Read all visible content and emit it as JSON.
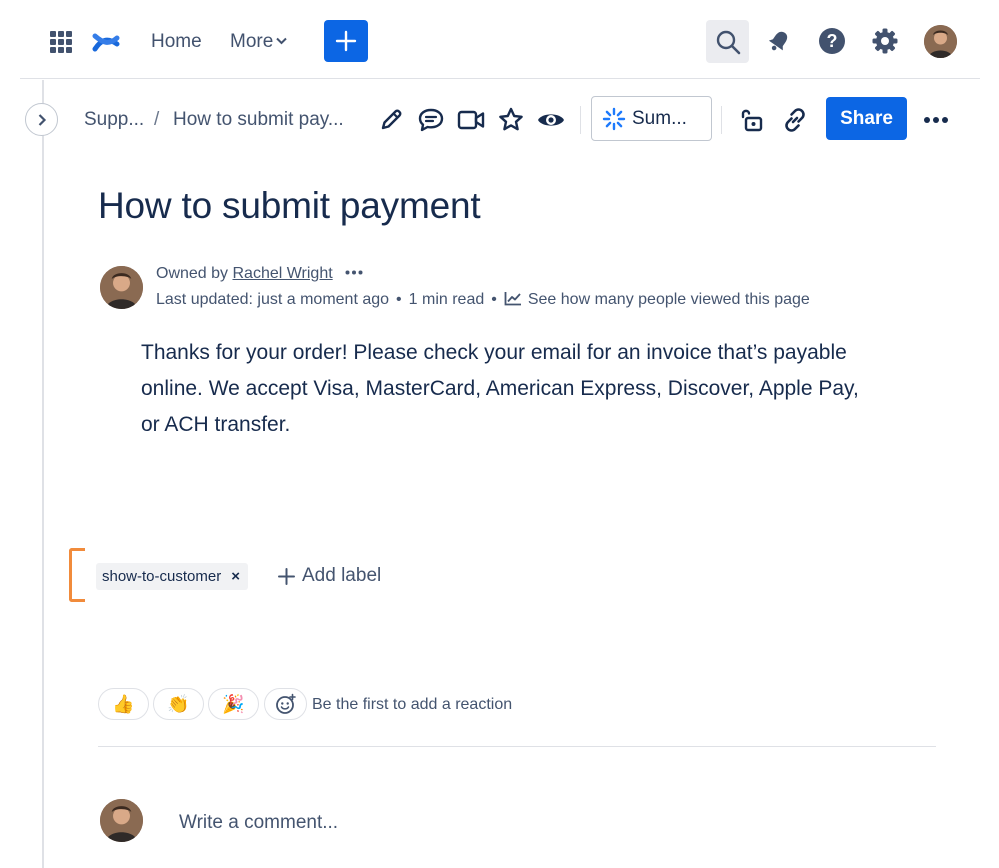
{
  "topnav": {
    "home_label": "Home",
    "more_label": "More"
  },
  "breadcrumb": {
    "space": "Supp...",
    "separator": "/",
    "page": "How to submit pay..."
  },
  "toolbar": {
    "summarize_label": "Sum...",
    "share_label": "Share"
  },
  "page": {
    "title": "How to submit payment",
    "byline": {
      "owned_by_prefix": "Owned by ",
      "owner": "Rachel Wright",
      "last_updated": "Last updated: just a moment ago",
      "read_time": "1 min read",
      "analytics_label": "See how many people viewed this page"
    },
    "body": "Thanks for your order! Please check your email for an invoice that’s payable online. We accept Visa, MasterCard, American Express, Discover, Apple Pay, or ACH transfer."
  },
  "labels": {
    "items": [
      {
        "name": "show-to-customer",
        "remove": "×"
      }
    ],
    "add_label": "Add label"
  },
  "reactions": {
    "emojis": [
      "👍",
      "👏",
      "🎉"
    ],
    "hint": "Be the first to add a reaction"
  },
  "comment": {
    "placeholder": "Write a comment..."
  },
  "colors": {
    "brand_blue": "#0c66e4",
    "text_primary": "#172b4d",
    "text_subtle": "#44546f",
    "label_bracket": "#f18b3b"
  }
}
